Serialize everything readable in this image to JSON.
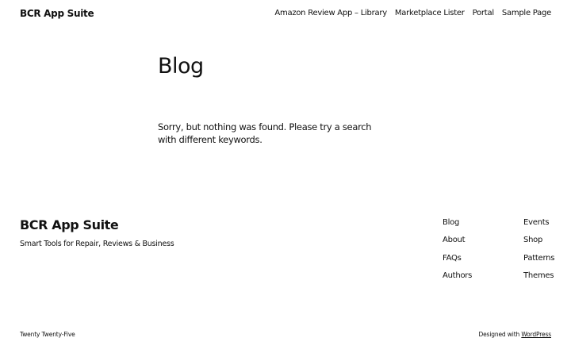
{
  "header": {
    "site_title": "BCR App Suite",
    "nav": [
      "Amazon Review App – Library",
      "Marketplace Lister",
      "Portal",
      "Sample Page"
    ]
  },
  "main": {
    "title": "Blog",
    "message": "Sorry, but nothing was found. Please try a search with different keywords."
  },
  "footer": {
    "site_title": "BCR App Suite",
    "tagline": "Smart Tools for Repair, Reviews & Business",
    "col1": [
      "Blog",
      "About",
      "FAQs",
      "Authors"
    ],
    "col2": [
      "Events",
      "Shop",
      "Patterns",
      "Themes"
    ],
    "theme_name": "Twenty Twenty-Five",
    "designed_with": "Designed with",
    "wp_link": "WordPress"
  }
}
